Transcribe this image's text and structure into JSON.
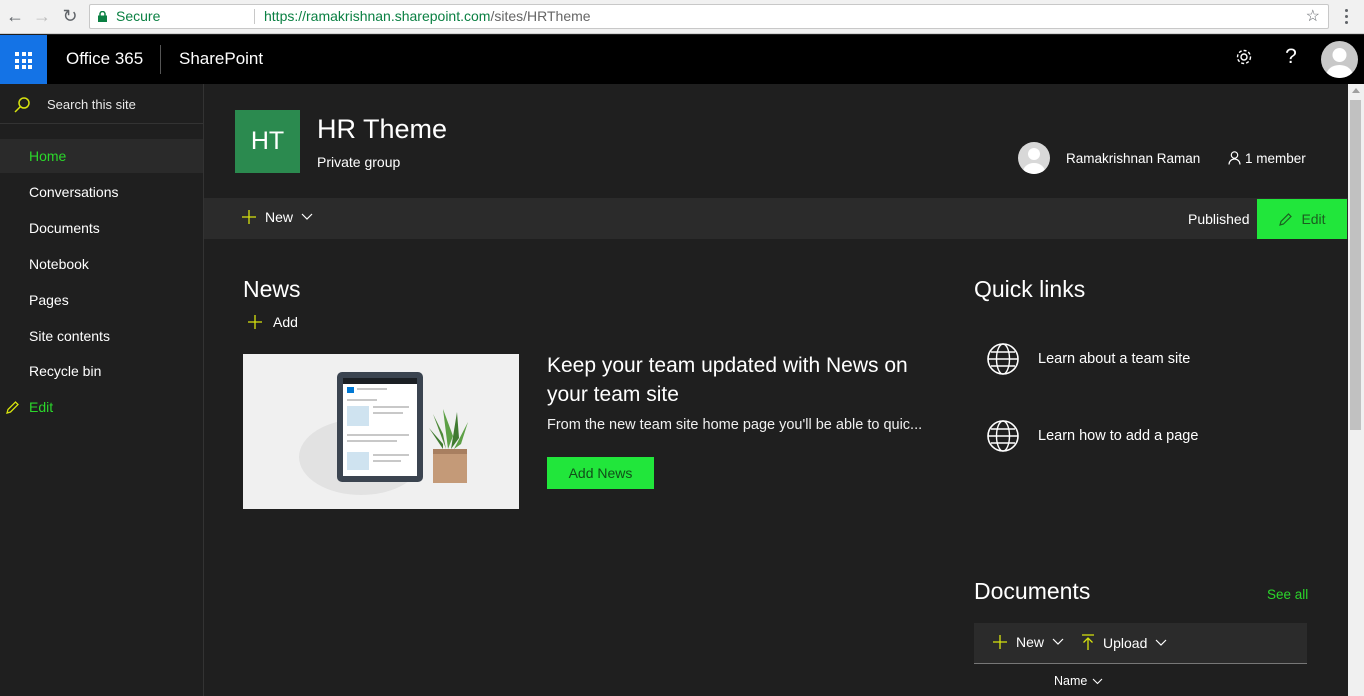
{
  "browser": {
    "secure_label": "Secure",
    "url_host": "https://ramakrishnan.sharepoint.com",
    "url_path": "/sites/HRTheme"
  },
  "suite": {
    "brand": "Office 365",
    "app": "SharePoint",
    "icons": [
      "app-launcher-icon",
      "gear-icon",
      "help-icon",
      "user-avatar"
    ]
  },
  "leftnav": {
    "search_placeholder": "Search this site",
    "items": [
      {
        "label": "Home"
      },
      {
        "label": "Conversations"
      },
      {
        "label": "Documents"
      },
      {
        "label": "Notebook"
      },
      {
        "label": "Pages"
      },
      {
        "label": "Site contents"
      },
      {
        "label": "Recycle bin"
      }
    ],
    "edit_label": "Edit"
  },
  "site": {
    "logo": "HT",
    "title": "HR Theme",
    "subtitle": "Private group",
    "owner": "Ramakrishnan Raman",
    "members": "1 member"
  },
  "commandbar": {
    "new_label": "New",
    "status": "Published",
    "edit_label": "Edit"
  },
  "news": {
    "heading": "News",
    "add_label": "Add",
    "headline": "Keep your team updated with News on your team site",
    "description": "From the new team site home page you'll be able to quic...",
    "button": "Add News"
  },
  "quicklinks": {
    "heading": "Quick links",
    "items": [
      {
        "label": "Learn about a team site"
      },
      {
        "label": "Learn how to add a page"
      }
    ]
  },
  "documents": {
    "heading": "Documents",
    "see_all": "See all",
    "new_label": "New",
    "upload_label": "Upload",
    "column_name": "Name"
  },
  "colors": {
    "accent_green": "#21e63b",
    "link_green": "#2bd72b",
    "logo_bg": "#2b8a4f",
    "launcher_blue": "#1473e6",
    "background": "#1f1f1f"
  }
}
